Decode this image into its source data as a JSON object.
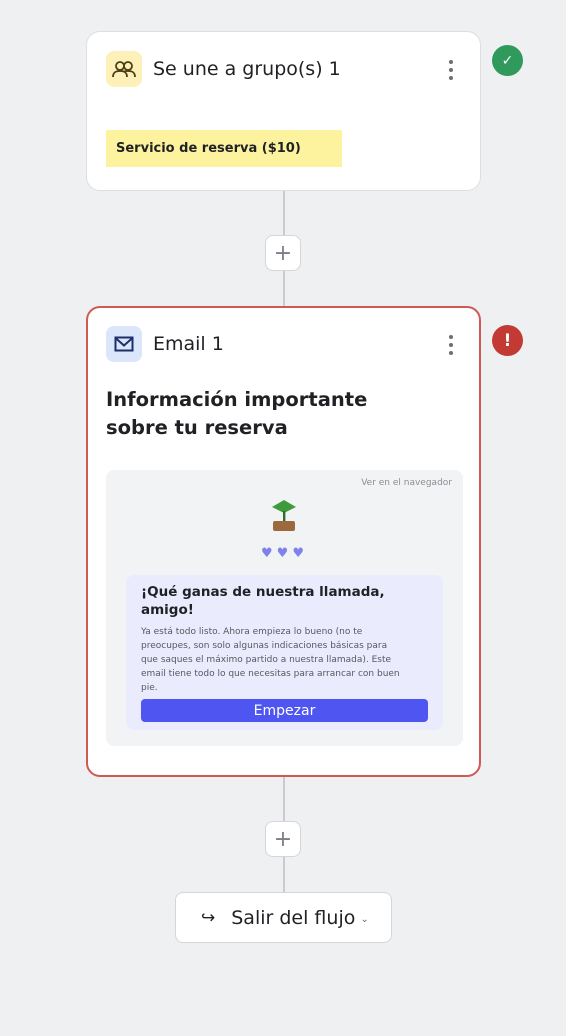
{
  "flow": {
    "step1": {
      "title": "Se une a grupo(s) 1",
      "icon": "group-icon",
      "tag": "Servicio de reserva ($10)",
      "status": "success",
      "status_symbol": "✓",
      "status_color": "#2f9a5c"
    },
    "add_symbol": "+",
    "step2": {
      "title": "Email 1",
      "icon": "envelope-icon",
      "subject": "Información importante sobre tu reserva",
      "status": "error",
      "status_symbol": "!",
      "status_color": "#c23a33",
      "preview": {
        "view_in_browser": "Ver en el navegador",
        "hearts": "♥♥♥",
        "heading": "¡Qué ganas de nuestra llamada, amigo!",
        "body": "Ya está todo listo. Ahora empieza lo bueno (no te preocupes, son solo algunas indicaciones básicas para que saques el máximo partido a nuestra llamada). Este email tiene todo lo que necesitas para arrancar con buen pie.",
        "button_label": "Empezar",
        "button_color": "#4f55f0"
      }
    },
    "exit": {
      "icon_symbol": "↪",
      "label": "Salir del flujo",
      "chevron": "⌄"
    }
  }
}
